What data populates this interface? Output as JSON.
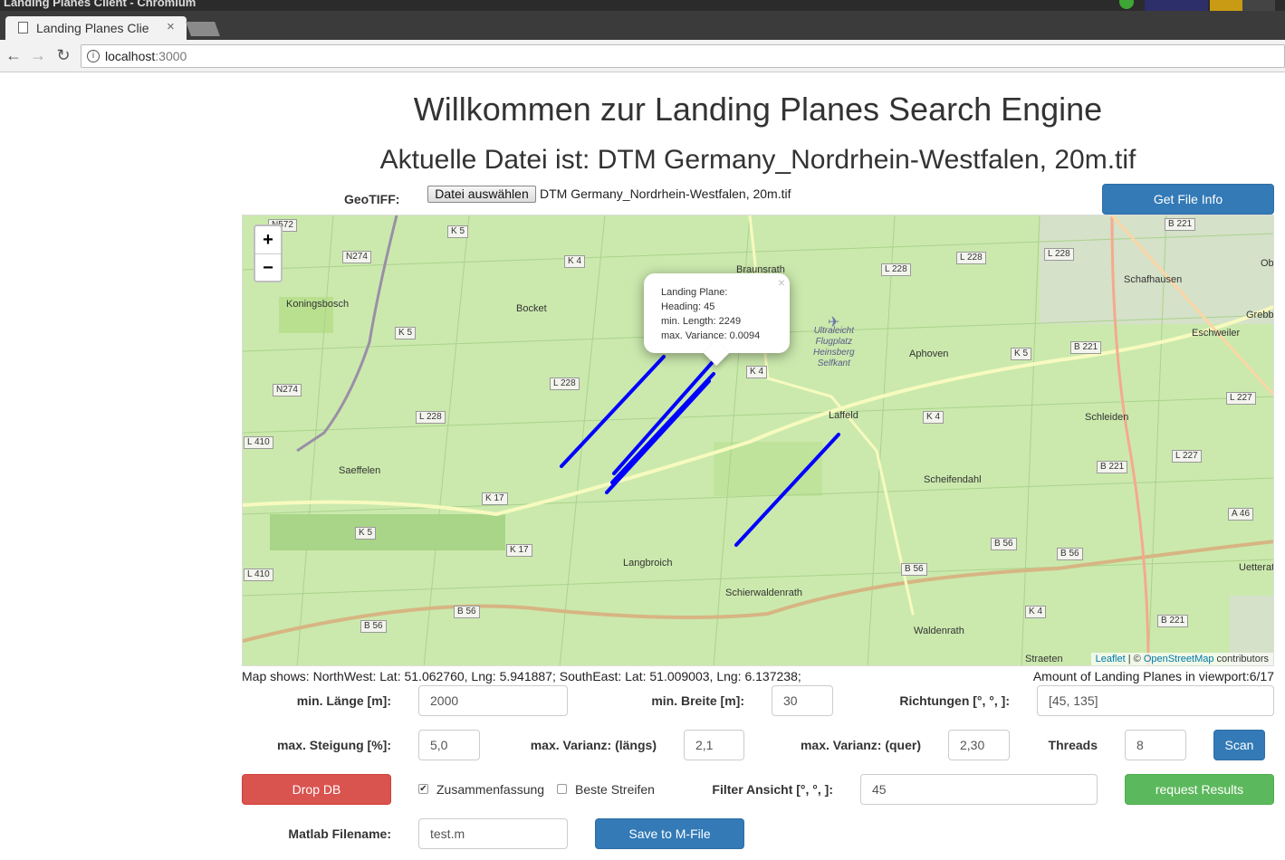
{
  "browser": {
    "window_title": "Landing Planes Client - Chromium",
    "tab_title": "Landing Planes Clie",
    "url_host": "localhost",
    "url_port": ":3000"
  },
  "page": {
    "title": "Willkommen zur Landing Planes Search Engine",
    "subtitle": "Aktuelle Datei ist: DTM Germany_Nordrhein-Westfalen, 20m.tif",
    "geotiff_label": "GeoTIFF:",
    "file_button": "Datei auswählen",
    "file_name": "DTM Germany_Nordrhein-Westfalen, 20m.tif",
    "get_file_info": "Get File Info"
  },
  "map": {
    "zoom_in": "+",
    "zoom_out": "−",
    "popup": {
      "close": "×",
      "lines": [
        "Landing Plane:",
        "Heading: 45",
        "min. Length: 2249",
        "max. Variance: 0.0094"
      ]
    },
    "attribution": {
      "leaflet": "Leaflet",
      "sep": " | © ",
      "osm": "OpenStreetMap",
      "contrib": " contributors"
    },
    "places": [
      "Koningsbosch",
      "Bocket",
      "Saeffelen",
      "Langbroich",
      "Schierwaldenrath",
      "Waldenrath",
      "Laffeld",
      "Aphoven",
      "Schleiden",
      "Scheifendahl",
      "Schafhausen",
      "Eschweiler",
      "Uetterat",
      "Braunsrath",
      "Straeten",
      "Grebbe",
      "Ob"
    ],
    "roads": [
      "N572",
      "N274",
      "N274",
      "K 5",
      "K 4",
      "K 5",
      "L 228",
      "L 228",
      "L 410",
      "L 410",
      "K 17",
      "K 17",
      "K 5",
      "B 56",
      "B 56",
      "L 228",
      "L 228",
      "L 228",
      "B 221",
      "B 221",
      "B 221",
      "B 221",
      "K 4",
      "K 4",
      "K 5",
      "L 227",
      "L 227",
      "A 46",
      "B 56",
      "B 56",
      "B 56",
      "K 4"
    ],
    "aerodrome": [
      "Ultraleicht",
      "Flugplatz",
      "Heinsberg",
      "Selfkant"
    ]
  },
  "status": {
    "viewport": "Map shows: NorthWest: Lat: 51.062760, Lng: 5.941887; SouthEast: Lat: 51.009003, Lng: 6.137238;",
    "amount": "Amount of Landing Planes in viewport:6/17"
  },
  "form": {
    "min_laenge_label": "min. Länge [m]:",
    "min_laenge": "2000",
    "min_breite_label": "min. Breite [m]:",
    "min_breite": "30",
    "richtungen_label": "Richtungen [°, °, ]:",
    "richtungen": "[45, 135]",
    "max_steigung_label": "max. Steigung [%]:",
    "max_steigung": "5,0",
    "max_var_laengs_label": "max. Varianz: (längs)",
    "max_var_laengs": "2,1",
    "max_var_quer_label": "max. Varianz: (quer)",
    "max_var_quer": "2,30",
    "threads_label": "Threads",
    "threads": "8",
    "scan": "Scan",
    "drop_db": "Drop DB",
    "zusammenfassung": "Zusammenfassung",
    "zusammenfassung_checked": true,
    "beste_streifen": "Beste Streifen",
    "beste_streifen_checked": false,
    "filter_label": "Filter Ansicht [°, °, ]:",
    "filter": "45",
    "request_results": "request Results",
    "matlab_label": "Matlab Filename:",
    "matlab": "test.m",
    "save_mfile": "Save to M-File"
  },
  "colors": {
    "primary": "#337ab7",
    "danger": "#d9534f",
    "success": "#5cb85c",
    "landing_plane": "#0000ff",
    "map_green": "#cbe9ad"
  }
}
